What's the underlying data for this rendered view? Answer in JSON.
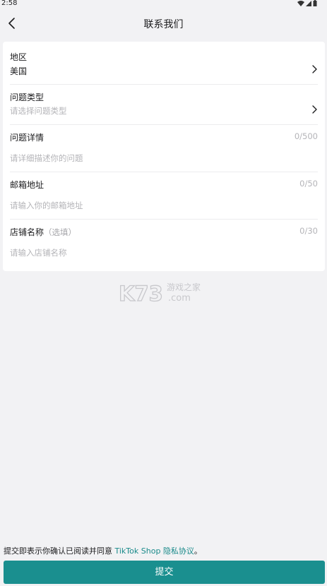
{
  "status": {
    "time": "2:58"
  },
  "nav": {
    "title": "联系我们"
  },
  "form": {
    "region": {
      "label": "地区",
      "value": "美国"
    },
    "issue_type": {
      "label": "问题类型",
      "placeholder": "请选择问题类型"
    },
    "details": {
      "label": "问题详情",
      "counter": "0/500",
      "placeholder": "请详细描述你的问题"
    },
    "email": {
      "label": "邮箱地址",
      "counter": "0/50",
      "placeholder": "请输入你的邮箱地址"
    },
    "shop_name": {
      "label": "店铺名称",
      "optional": "（选填）",
      "counter": "0/30",
      "placeholder": "请输入店铺名称"
    }
  },
  "watermark": {
    "brand": "K73",
    "tagline": "游戏之家",
    "domain": ".com"
  },
  "footer": {
    "consent_text": "提交即表示你确认已阅读并同意 ",
    "policy_link": "TikTok Shop 隐私协议",
    "period": "。"
  },
  "submit": {
    "label": "提交"
  },
  "colors": {
    "accent": "#1a8f8f",
    "link": "#1a8a8a",
    "background": "#f2f2f4"
  }
}
